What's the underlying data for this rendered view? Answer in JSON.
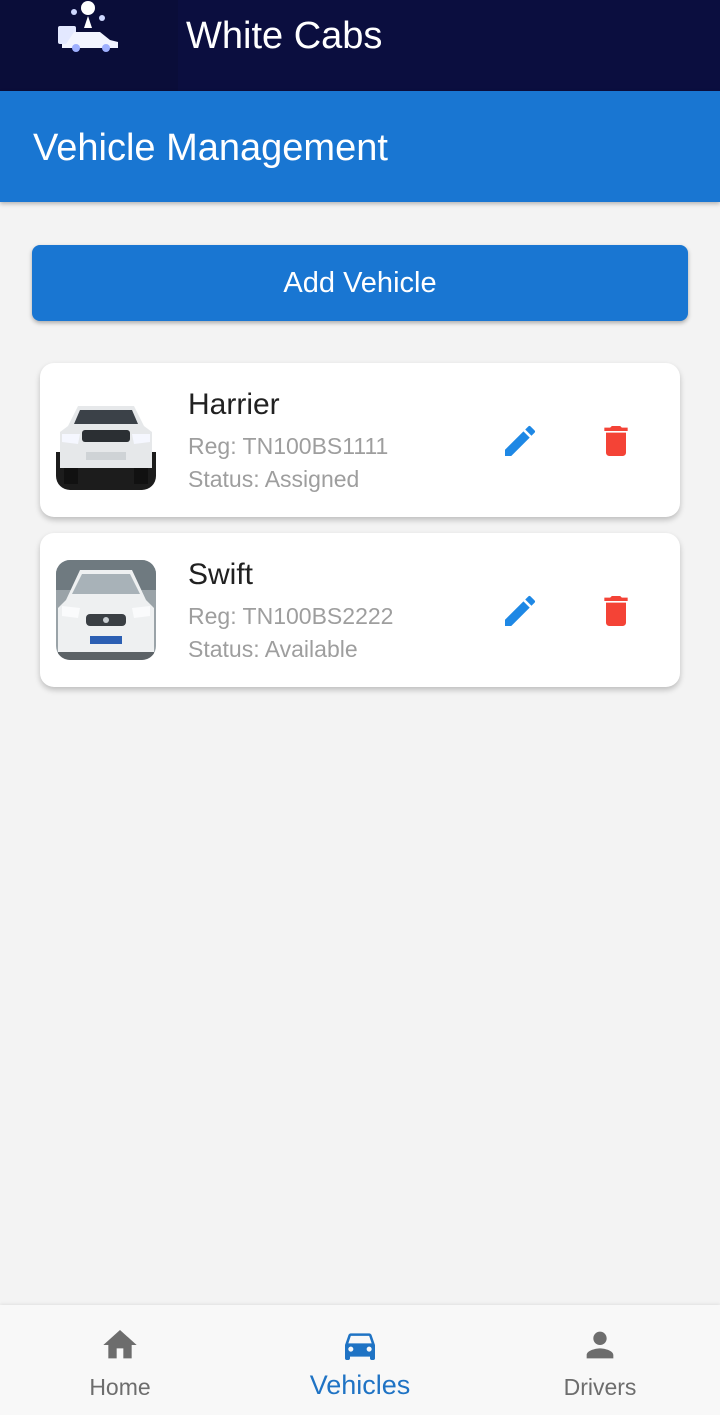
{
  "app": {
    "title": "White Cabs"
  },
  "header": {
    "title": "Vehicle Management"
  },
  "actions": {
    "add_vehicle_label": "Add Vehicle"
  },
  "vehicles": [
    {
      "name": "Harrier",
      "reg": "Reg: TN100BS1111",
      "status": "Status: Assigned",
      "thumbnail": "car-photo-dark-grille"
    },
    {
      "name": "Swift",
      "reg": "Reg: TN100BS2222",
      "status": "Status: Available",
      "thumbnail": "car-photo-white-hatchback"
    }
  ],
  "bottom_nav": {
    "items": [
      {
        "label": "Home",
        "icon": "home-icon",
        "active": false
      },
      {
        "label": "Vehicles",
        "icon": "car-icon",
        "active": true
      },
      {
        "label": "Drivers",
        "icon": "person-icon",
        "active": false
      }
    ]
  },
  "colors": {
    "top_bar": "#0b0e3f",
    "primary": "#1976d2",
    "edit_icon": "#1e88e5",
    "delete_icon": "#f44336",
    "active_nav": "#1f73c4",
    "inactive_nav": "#6d6d6d"
  }
}
